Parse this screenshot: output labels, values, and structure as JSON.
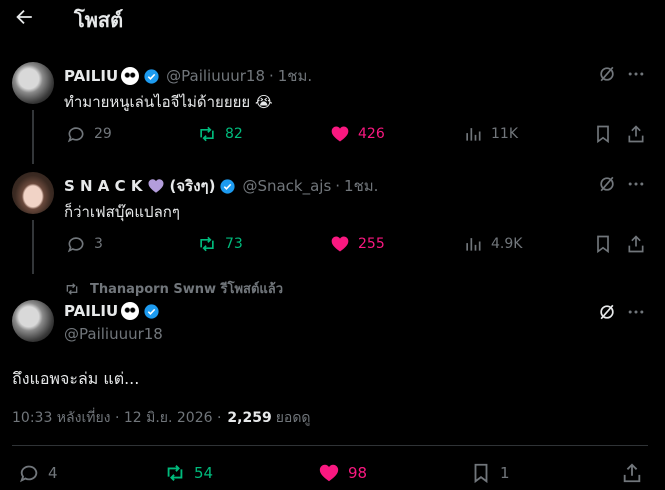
{
  "header": {
    "title": "โพสต์"
  },
  "reply1": {
    "name": "PAILIU",
    "handle": "@Pailiuuur18",
    "time": "1ชม.",
    "text": "ทำมายหนูเล่นไอจีไม่ด้ายยยย 😭",
    "replies": "29",
    "reposts": "82",
    "likes": "426",
    "views": "11K"
  },
  "reply2": {
    "name": "S N A C K",
    "name_suffix": "(จริงๆ)",
    "handle": "@Snack_ajs",
    "time": "1ชม.",
    "text": "ก็ว่าเฟสบุ๊คแปลกๆ",
    "replies": "3",
    "reposts": "73",
    "likes": "255",
    "views": "4.9K"
  },
  "main": {
    "repost_label": "Thanaporn Swnw รีโพสต์แล้ว",
    "name": "PAILIU",
    "handle": "@Pailiuuur18",
    "text": "ถึงแอพจะล่ม แต่...",
    "timestamp": "10:33 หลังเที่ยง · 12 มิ.ย. 2026 ·",
    "views_count": "2,259",
    "views_label": "ยอดดู",
    "replies": "4",
    "reposts": "54",
    "likes": "98",
    "bookmarks": "1"
  },
  "colors": {
    "repost_green": "#00ba7c",
    "like_pink": "#f91880",
    "verified_blue": "#1d9bf0",
    "muted": "#71767b"
  }
}
